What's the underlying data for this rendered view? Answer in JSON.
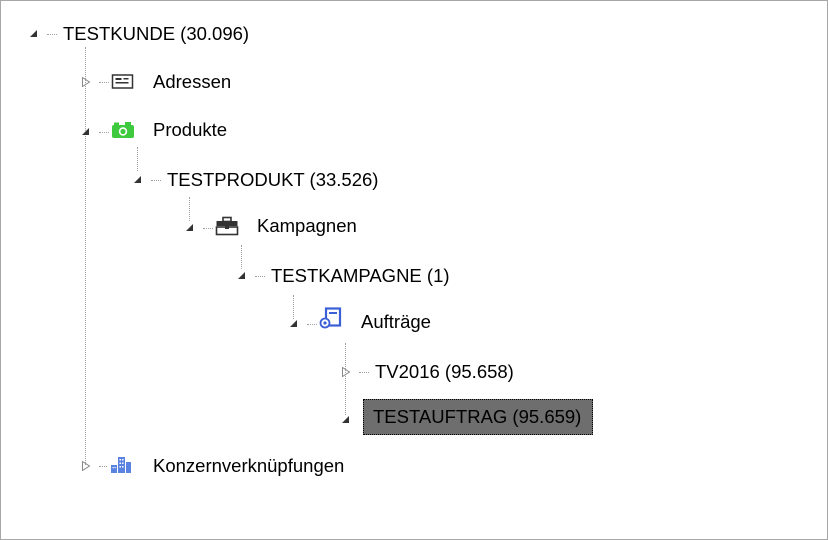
{
  "tree": {
    "root": {
      "label": "TESTKUNDE (30.096)",
      "state": "expanded"
    },
    "adressen": {
      "label": "Adressen",
      "icon": "address-card-icon",
      "state": "collapsed"
    },
    "produkte": {
      "label": "Produkte",
      "icon": "camera-icon",
      "icon_color": "#3fc93f",
      "state": "expanded"
    },
    "testprodukt": {
      "label": "TESTPRODUKT (33.526)",
      "state": "expanded"
    },
    "kampagnen": {
      "label": "Kampagnen",
      "icon": "briefcase-icon",
      "state": "expanded"
    },
    "testkampagne": {
      "label": "TESTKAMPAGNE (1)",
      "state": "expanded"
    },
    "auftraege": {
      "label": "Aufträge",
      "icon": "order-form-icon",
      "icon_color": "#3a5fd6",
      "state": "expanded"
    },
    "tv2016": {
      "label": "TV2016 (95.658)",
      "state": "collapsed"
    },
    "testauftrag": {
      "label": "TESTAUFTRAG (95.659)",
      "state": "expanded",
      "selected": true
    },
    "konzern": {
      "label": "Konzernverknüpfungen",
      "icon": "buildings-icon",
      "icon_color": "#5a82e0",
      "state": "collapsed"
    }
  },
  "colors": {
    "selection_bg": "#6e6e6e",
    "tree_lines": "#a0a0a0",
    "border": "#a7a7a7"
  }
}
